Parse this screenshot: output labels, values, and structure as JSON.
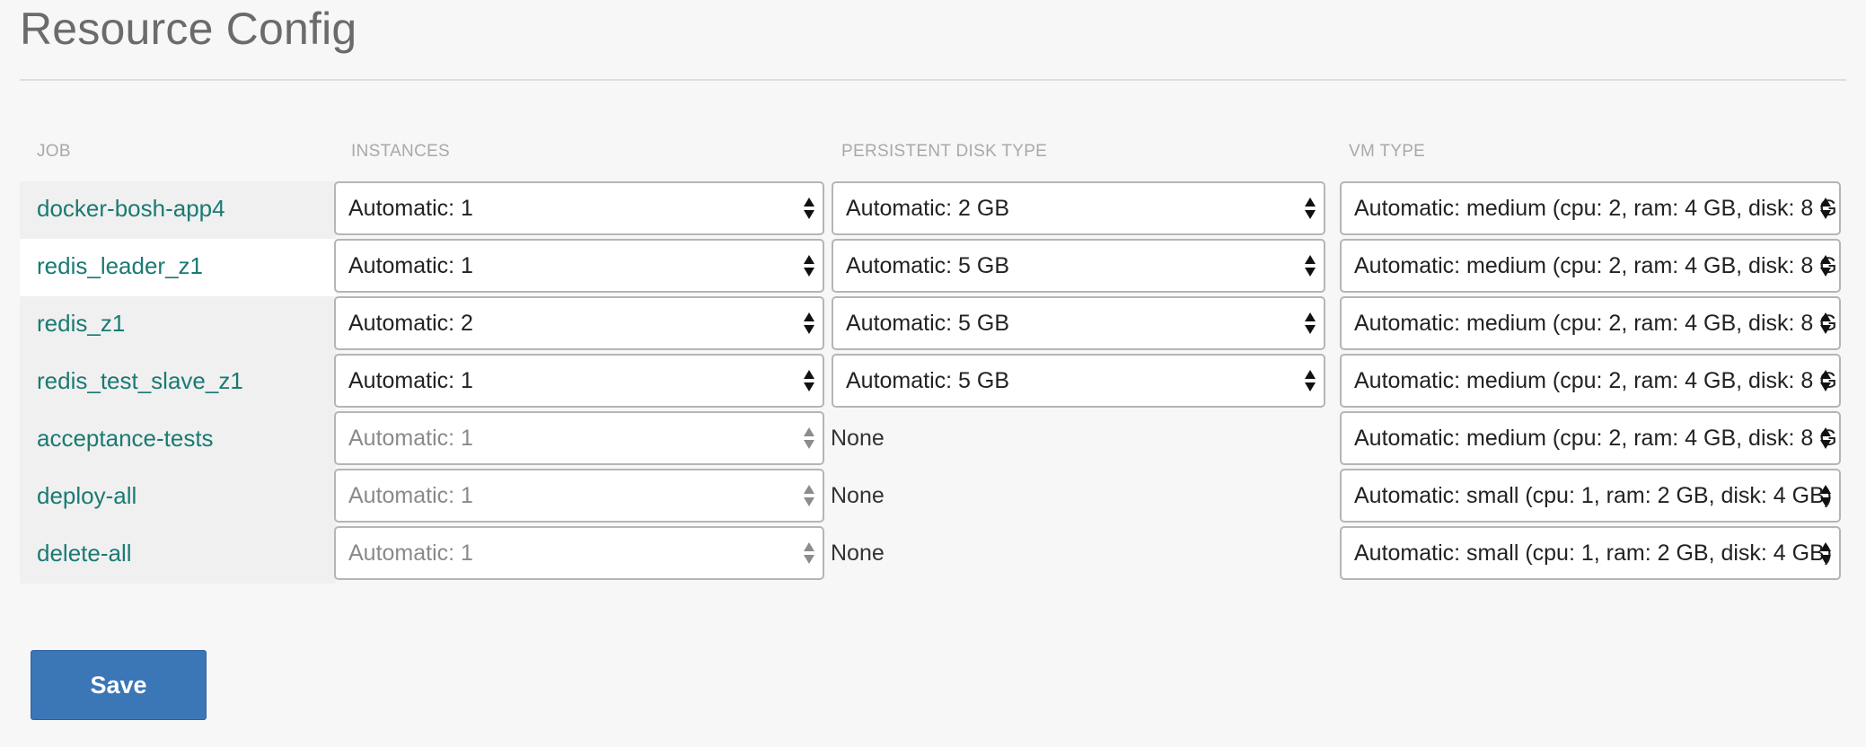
{
  "page": {
    "title": "Resource Config"
  },
  "table": {
    "headers": {
      "job": "JOB",
      "instances": "INSTANCES",
      "disk": "PERSISTENT DISK TYPE",
      "vm": "VM TYPE"
    },
    "rows": [
      {
        "job": "docker-bosh-app4",
        "instances": "Automatic: 1",
        "instances_disabled": false,
        "disk": "Automatic: 2 GB",
        "disk_none": false,
        "vm": "Automatic: medium (cpu: 2, ram: 4 GB, disk: 8 G"
      },
      {
        "job": "redis_leader_z1",
        "instances": "Automatic: 1",
        "instances_disabled": false,
        "disk": "Automatic: 5 GB",
        "disk_none": false,
        "vm": "Automatic: medium (cpu: 2, ram: 4 GB, disk: 8 G"
      },
      {
        "job": "redis_z1",
        "instances": "Automatic: 2",
        "instances_disabled": false,
        "disk": "Automatic: 5 GB",
        "disk_none": false,
        "vm": "Automatic: medium (cpu: 2, ram: 4 GB, disk: 8 G"
      },
      {
        "job": "redis_test_slave_z1",
        "instances": "Automatic: 1",
        "instances_disabled": false,
        "disk": "Automatic: 5 GB",
        "disk_none": false,
        "vm": "Automatic: medium (cpu: 2, ram: 4 GB, disk: 8 G"
      },
      {
        "job": "acceptance-tests",
        "instances": "Automatic: 1",
        "instances_disabled": true,
        "disk": "None",
        "disk_none": true,
        "vm": "Automatic: medium (cpu: 2, ram: 4 GB, disk: 8 G"
      },
      {
        "job": "deploy-all",
        "instances": "Automatic: 1",
        "instances_disabled": true,
        "disk": "None",
        "disk_none": true,
        "vm": "Automatic: small (cpu: 1, ram: 2 GB, disk: 4 GB)"
      },
      {
        "job": "delete-all",
        "instances": "Automatic: 1",
        "instances_disabled": true,
        "disk": "None",
        "disk_none": true,
        "vm": "Automatic: small (cpu: 1, ram: 2 GB, disk: 4 GB)"
      }
    ]
  },
  "actions": {
    "save_label": "Save"
  },
  "colors": {
    "job_link": "#1a7a73",
    "save_button": "#3b76b7",
    "header_text": "#a9a9a9",
    "disabled_text": "#8a8a8a"
  },
  "icons": {
    "select_arrows": "up-down-arrows-icon"
  }
}
